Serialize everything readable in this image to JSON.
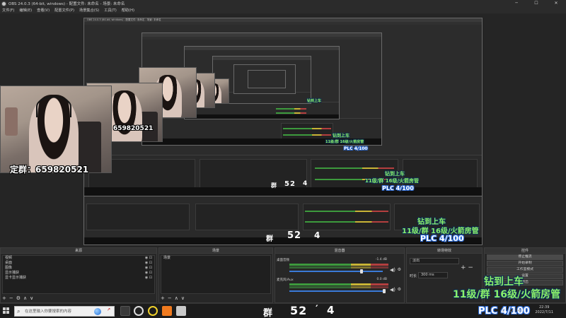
{
  "window": {
    "title": "OBS 24.0.3 (64-bit, windows) - 配置文件: 未命名 - 场景: 未命名",
    "minimize": "─",
    "maximize": "☐",
    "close": "✕"
  },
  "menu": [
    "文件(F)",
    "编辑(E)",
    "查看(V)",
    "配置文件(P)",
    "场景集合(S)",
    "工具(T)",
    "帮助(H)"
  ],
  "overlay": {
    "qq_group": "定群：659820521",
    "qq_group_small": "659820521",
    "promo_line1": "钻到上车",
    "promo_line2": "11级/群 16级/火箭房管",
    "plc": "PLC 4/100",
    "hud_left": "52",
    "hud_mark": "′",
    "hud_right": "4",
    "hud_glyph": "群"
  },
  "docks": {
    "scenes": {
      "header": "场景",
      "items": [
        "场景"
      ]
    },
    "sources": {
      "header": "来源",
      "items": [
        "视频",
        "桌面",
        "图像",
        "显示捕获",
        "显卡显示捕获"
      ]
    },
    "mixer": {
      "header": "混音器",
      "channels": [
        {
          "name": "桌面音频",
          "db": "-1.4 dB"
        },
        {
          "name": "麦克风/Aux",
          "db": "0.0 dB"
        }
      ]
    },
    "transitions": {
      "header": "转场特效",
      "type": "淡出",
      "duration_label": "时长",
      "duration_value": "300 ms"
    },
    "controls": {
      "header": "控件",
      "buttons": [
        "停止推流",
        "开始录制",
        "工作室模式",
        "设置",
        "退出"
      ]
    }
  },
  "taskbar": {
    "search_placeholder": "在这里输入你要搜索的内容",
    "time": "22:39",
    "date": "2022/7/11",
    "tray": "∧ ▭ ◀)"
  }
}
